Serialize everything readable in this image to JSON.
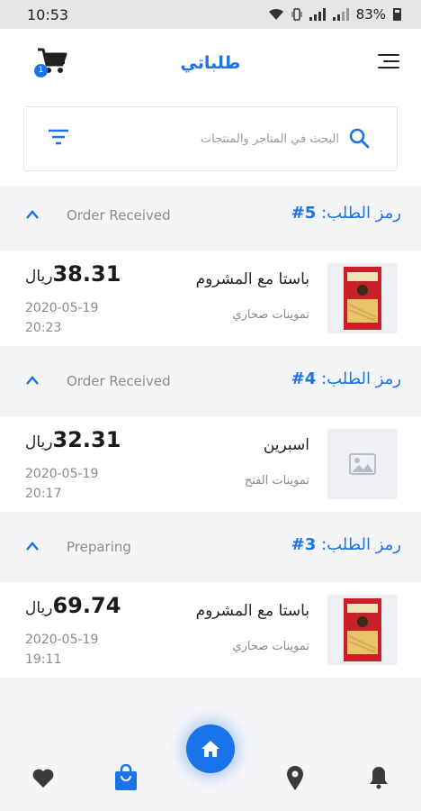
{
  "status_bar": {
    "time": "10:53",
    "battery": "83%"
  },
  "header": {
    "title": "طلباتي",
    "cart_count": "1"
  },
  "search": {
    "placeholder": "البحث في المتاجر والمنتجات"
  },
  "orders": [
    {
      "code_label": "رمز الطلب:",
      "code_number": "5#",
      "status": "Order Received",
      "item": {
        "name": "باستا مع المشروم",
        "store": "تموينات صحاري",
        "price": "38.31",
        "currency": "ريال",
        "date": "2020-05-19",
        "time": "20:23",
        "image": "pasta-box"
      }
    },
    {
      "code_label": "رمز الطلب:",
      "code_number": "4#",
      "status": "Order Received",
      "item": {
        "name": "اسبرين",
        "store": "تموينات الفتح",
        "price": "32.31",
        "currency": "ريال",
        "date": "2020-05-19",
        "time": "20:17",
        "image": "placeholder"
      }
    },
    {
      "code_label": "رمز الطلب:",
      "code_number": "3#",
      "status": "Preparing",
      "item": {
        "name": "باستا مع المشروم",
        "store": "تموينات صحاري",
        "price": "69.74",
        "currency": "ريال",
        "date": "2020-05-19",
        "time": "19:11",
        "image": "pasta-box"
      }
    }
  ],
  "bottom_nav": {
    "items": [
      {
        "icon": "heart-icon"
      },
      {
        "icon": "shopping-bag-icon",
        "active": true
      },
      {
        "icon": "home-icon"
      },
      {
        "icon": "location-pin-icon"
      },
      {
        "icon": "bell-icon"
      }
    ]
  },
  "colors": {
    "accent": "#1a73e8",
    "background": "#f4f5f7",
    "status_gray": "#8c8c8c"
  }
}
